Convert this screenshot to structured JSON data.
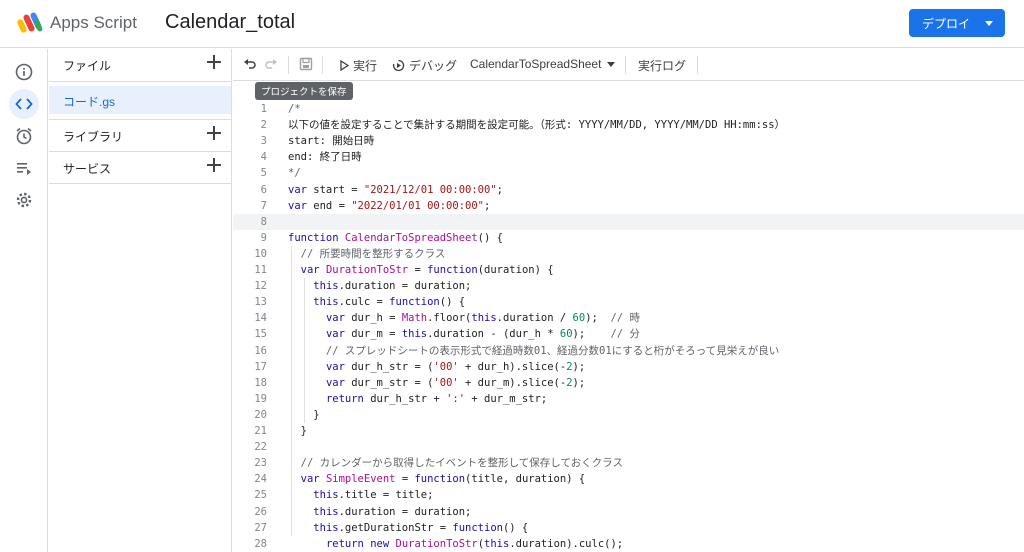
{
  "header": {
    "app_name": "Apps Script",
    "project_title": "Calendar_total",
    "deploy_label": "デプロイ"
  },
  "rail": {
    "items": [
      "info-icon",
      "code-icon",
      "alarm-icon",
      "executions-icon",
      "gear-icon"
    ],
    "active": "code-icon"
  },
  "files_panel": {
    "files_label": "ファイル",
    "file_name": "コード.gs",
    "libraries_label": "ライブラリ",
    "services_label": "サービス"
  },
  "toolbar": {
    "run_label": "実行",
    "debug_label": "デバッグ",
    "function_name": "CalendarToSpreadSheet",
    "log_label": "実行ログ",
    "save_tooltip": "プロジェクトを保存"
  },
  "editor": {
    "current_line": 8,
    "lines": [
      {
        "n": "1",
        "text": "/*"
      },
      {
        "n": "2",
        "text": "以下の値を設定することで集計する期間を設定可能。（形式: YYYY/MM/DD, YYYY/MM/DD HH:mm:ss）"
      },
      {
        "n": "3",
        "text": "start: 開始日時"
      },
      {
        "n": "4",
        "text": "end: 終了日時"
      },
      {
        "n": "5",
        "text": "*/"
      },
      {
        "n": "6",
        "text": "var start = \"2021/12/01 00:00:00\";"
      },
      {
        "n": "7",
        "text": "var end = \"2022/01/01 00:00:00\";"
      },
      {
        "n": "8",
        "text": ""
      },
      {
        "n": "9",
        "text": "function CalendarToSpreadSheet() {"
      },
      {
        "n": "10",
        "text": "  // 所要時間を整形するクラス"
      },
      {
        "n": "11",
        "text": "  var DurationToStr = function(duration) {"
      },
      {
        "n": "12",
        "text": "    this.duration = duration;"
      },
      {
        "n": "13",
        "text": "    this.culc = function() {"
      },
      {
        "n": "14",
        "text": "      var dur_h = Math.floor(this.duration / 60);  // 時"
      },
      {
        "n": "15",
        "text": "      var dur_m = this.duration - (dur_h * 60);    // 分"
      },
      {
        "n": "16",
        "text": "      // スプレッドシートの表示形式で経過時数01、経過分数01にすると桁がそろって見栄えが良い"
      },
      {
        "n": "17",
        "text": "      var dur_h_str = ('00' + dur_h).slice(-2);"
      },
      {
        "n": "18",
        "text": "      var dur_m_str = ('00' + dur_m).slice(-2);"
      },
      {
        "n": "19",
        "text": "      return dur_h_str + ':' + dur_m_str;"
      },
      {
        "n": "20",
        "text": "    }"
      },
      {
        "n": "21",
        "text": "  }"
      },
      {
        "n": "22",
        "text": ""
      },
      {
        "n": "23",
        "text": "  // カレンダーから取得したイベントを整形して保存しておくクラス"
      },
      {
        "n": "24",
        "text": "  var SimpleEvent = function(title, duration) {"
      },
      {
        "n": "25",
        "text": "    this.title = title;"
      },
      {
        "n": "26",
        "text": "    this.duration = duration;"
      },
      {
        "n": "27",
        "text": "    this.getDurationStr = function() {"
      },
      {
        "n": "28",
        "text": "      return new DurationToStr(this.duration).culc();"
      }
    ]
  }
}
